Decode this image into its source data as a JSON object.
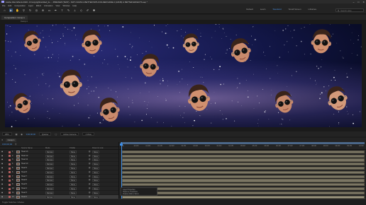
{
  "window": {
    "title": "Adobe After Effects 2020 - D:\\copyright\\untitled_fa... - PREVIEW (TEST) - NOT A DATA in BETTER WITH FOLDER NAME 2 (12345) in BETTER EFFECTS.aep *",
    "controls": [
      "–",
      "□",
      "✕"
    ]
  },
  "menu": [
    "File",
    "Edit",
    "Composition",
    "Layer",
    "Effect",
    "Animation",
    "View",
    "Window",
    "Help"
  ],
  "toolbar": {
    "tools": [
      {
        "icon": "home-icon",
        "glyph": "⌂"
      },
      {
        "icon": "selection-tool-icon",
        "glyph": "▶",
        "active": true
      },
      {
        "icon": "hand-tool-icon",
        "glyph": "✋"
      },
      {
        "icon": "zoom-tool-icon",
        "glyph": "⚲"
      },
      {
        "icon": "rotate-tool-icon",
        "glyph": "↻"
      },
      {
        "icon": "camera-tool-icon",
        "glyph": "◎"
      },
      {
        "icon": "pan-behind-tool-icon",
        "glyph": "⊕"
      },
      {
        "icon": "rectangle-tool-icon",
        "glyph": "▭"
      },
      {
        "icon": "pen-tool-icon",
        "glyph": "✒"
      },
      {
        "icon": "type-tool-icon",
        "glyph": "T"
      },
      {
        "icon": "brush-tool-icon",
        "glyph": "✎"
      },
      {
        "icon": "clone-stamp-tool-icon",
        "glyph": "⊥"
      },
      {
        "icon": "eraser-tool-icon",
        "glyph": "◇"
      },
      {
        "icon": "roto-brush-tool-icon",
        "glyph": "✐"
      },
      {
        "icon": "puppet-tool-icon",
        "glyph": "✱"
      }
    ],
    "workspaces": [
      "Default",
      "Learn",
      "Standard",
      "Small Screen",
      "Libraries"
    ],
    "active_workspace": "Standard",
    "search_placeholder": "Search Help"
  },
  "composition": {
    "tab_label": "Composition: Comp 1",
    "subtab_label": "Comp 1"
  },
  "heads": [
    {
      "id": 1,
      "shade": "#c98a6c"
    },
    {
      "id": 2,
      "shade": "#d0906f"
    },
    {
      "id": 3,
      "shade": "#c98a6c"
    },
    {
      "id": 4,
      "shade": "#d39a7a"
    },
    {
      "id": 5,
      "shade": "#c98a6c"
    },
    {
      "id": 6,
      "shade": "#d0906f"
    },
    {
      "id": 7,
      "shade": "#c98a6c"
    },
    {
      "id": 8,
      "shade": "#d39a7a"
    },
    {
      "id": 9,
      "shade": "#c98a6c"
    },
    {
      "id": 10,
      "shade": "#d0906f"
    },
    {
      "id": 11,
      "shade": "#c98a6c"
    },
    {
      "id": 12,
      "shade": "#d39a7a"
    }
  ],
  "viewer_controls": {
    "zoom": "25%",
    "timecode": "0;00;00;00",
    "resolution": "Quarter",
    "camera": "Active Camera",
    "views": "1 View"
  },
  "timeline": {
    "tab_label": "Comp 1",
    "timecode": "0;00;00;00",
    "columns": {
      "source": "Source Name",
      "mode": "Mode",
      "trkmat": "TrkMat",
      "parent": "Parent & Link"
    },
    "ruler_ticks": [
      "0s",
      "00:15f",
      "01:00f",
      "01:15f",
      "02:00f",
      "02:15f",
      "03:00f",
      "03:15f",
      "04:00f",
      "04:15f",
      "05:00f",
      "05:15f",
      "06:00f",
      "06:15f",
      "07:00f",
      "07:15f",
      "08:00f",
      "08:15f",
      "09:00f",
      "09:15f",
      "10:00f"
    ],
    "layers": [
      {
        "num": "1",
        "name": "Head 13",
        "mode": "Normal",
        "trkmat": "None",
        "parent": "None",
        "color": "#b55f5f"
      },
      {
        "num": "2",
        "name": "Head 12",
        "mode": "Normal",
        "trkmat": "None",
        "parent": "None",
        "color": "#b55f5f"
      },
      {
        "num": "3",
        "name": "Head 11",
        "mode": "Normal",
        "trkmat": "None",
        "parent": "None",
        "color": "#b55f5f"
      },
      {
        "num": "4",
        "name": "Head 10",
        "mode": "Normal",
        "trkmat": "None",
        "parent": "None",
        "color": "#b55f5f"
      },
      {
        "num": "5",
        "name": "Head 9",
        "mode": "Normal",
        "trkmat": "None",
        "parent": "None",
        "color": "#b55f5f"
      },
      {
        "num": "6",
        "name": "Head 8",
        "mode": "Normal",
        "trkmat": "None",
        "parent": "None",
        "color": "#b55f5f"
      },
      {
        "num": "7",
        "name": "Head 7",
        "mode": "Normal",
        "trkmat": "None",
        "parent": "None",
        "color": "#b55f5f"
      },
      {
        "num": "8",
        "name": "Head 6",
        "mode": "Normal",
        "trkmat": "None",
        "parent": "None",
        "color": "#b55f5f"
      },
      {
        "num": "9",
        "name": "Head 5",
        "mode": "Normal",
        "trkmat": "None",
        "parent": "None",
        "color": "#b55f5f"
      },
      {
        "num": "10",
        "name": "Head 4",
        "mode": "Normal",
        "trkmat": "None",
        "parent": "None",
        "color": "#b55f5f"
      },
      {
        "num": "11",
        "name": "Head 3",
        "mode": "Normal",
        "trkmat": "None",
        "parent": "None",
        "color": "#b55f5f"
      },
      {
        "num": "12",
        "name": "Head 2",
        "mode": "Normal",
        "trkmat": "None",
        "parent": "None",
        "color": "#b55f5f",
        "selected": true
      },
      {
        "num": "13",
        "name": "Stars",
        "mode": "Normal",
        "trkmat": "None",
        "parent": "None",
        "color": "#6a8fbf"
      }
    ]
  },
  "properties_box": {
    "line1": "Layer Properties",
    "line2": "Head 2  ▸  Transform",
    "line3": "Position 960.0, 540.0"
  },
  "status": "Toggle Switches / Modes"
}
